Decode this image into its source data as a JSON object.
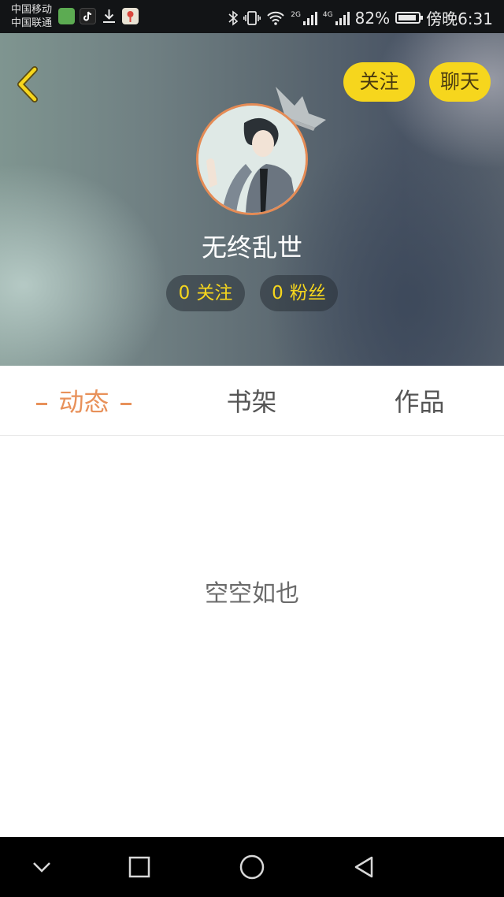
{
  "status_bar": {
    "carrier_1": "中国移动",
    "carrier_2": "中国联通",
    "network_2g": "2G",
    "network_4g": "4G",
    "battery": "82%",
    "time": "傍晚6:31"
  },
  "header": {
    "follow_label": "关注",
    "chat_label": "聊天",
    "username": "无终乱世",
    "following_count": "0",
    "following_label": "关注",
    "fans_count": "0",
    "fans_label": "粉丝"
  },
  "tabs": [
    {
      "label": "动态",
      "active": true
    },
    {
      "label": "书架",
      "active": false
    },
    {
      "label": "作品",
      "active": false
    }
  ],
  "content": {
    "empty_text": "空空如也"
  },
  "colors": {
    "accent_yellow": "#f6d61d",
    "active_tab": "#e8915a",
    "avatar_border": "#e58b55"
  },
  "icons": [
    "back-arrow-icon",
    "crown-icon",
    "nav-down-icon",
    "nav-square-icon",
    "nav-circle-icon",
    "nav-back-triangle-icon"
  ]
}
